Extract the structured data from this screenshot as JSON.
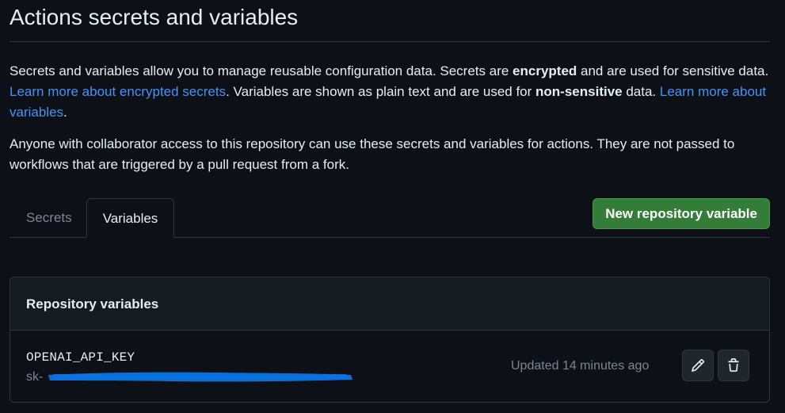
{
  "page": {
    "title": "Actions secrets and variables"
  },
  "intro": {
    "p1_a": "Secrets and variables allow you to manage reusable configuration data. Secrets are ",
    "p1_b": "encrypted",
    "p1_c": " and are used for sensitive data. ",
    "p1_link1": "Learn more about encrypted secrets",
    "p1_d": ". Variables are shown as plain text and are used for ",
    "p1_e": "non-sensitive",
    "p1_f": " data. ",
    "p1_link2": "Learn more about variables",
    "p1_g": ".",
    "p2": "Anyone with collaborator access to this repository can use these secrets and variables for actions. They are not passed to workflows that are triggered by a pull request from a fork."
  },
  "tabs": [
    {
      "label": "Secrets",
      "selected": false
    },
    {
      "label": "Variables",
      "selected": true
    }
  ],
  "actions": {
    "new_variable_label": "New repository variable"
  },
  "variables_box": {
    "header": "Repository variables",
    "rows": [
      {
        "name": "OPENAI_API_KEY",
        "value_prefix": "sk-",
        "value_redacted": true,
        "updated": "Updated 14 minutes ago"
      }
    ]
  },
  "icons": {
    "edit": "pencil-icon",
    "delete": "trash-icon"
  },
  "colors": {
    "background": "#0d1117",
    "link": "#4493f8",
    "primary_button": "#347d39",
    "muted_text": "#7d8590",
    "border": "#30363d",
    "redaction": "#0a6fd6"
  }
}
